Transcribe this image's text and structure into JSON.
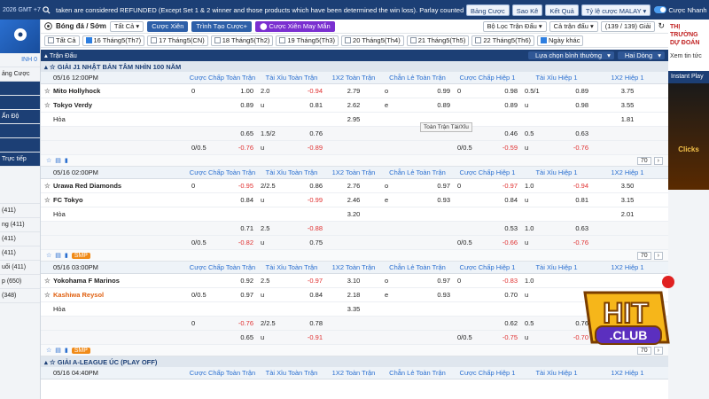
{
  "topbar": {
    "time": "2026 GMT +7",
    "news": "taken are considered REFUNDED (Except Set 1 & 2 winner and those products which have been determined the win loss). Parlay counted as",
    "buttons": [
      "Bảng Cược",
      "Sao Kê",
      "Kết Quả",
      "Tỷ lệ cược MALAY"
    ],
    "quick_bet": "Cược Nhanh"
  },
  "leftpanel": {
    "banner": "",
    "rows": [
      "INH 0",
      "ảng Cược",
      "",
      "",
      "Ấn Độ",
      "",
      "",
      "Trực tiếp",
      "",
      "(411)",
      "ng (411)",
      "(411)",
      "(411)",
      "uối (411)",
      "p (650)",
      "(348)"
    ]
  },
  "filter": {
    "sport": "Bóng đá / Sớm",
    "all": "Tất Cả",
    "btn1": "Cược Xiên",
    "btn2": "Trình Tạo Cược+",
    "btn3": "Cược Xiên May Mắn",
    "match_filter": "Bộ Lọc Trận Đấu",
    "odds_sort": "Cả trận đấu",
    "count": "(139 / 139)",
    "league_select": "Giải"
  },
  "dates": [
    "Tất Cả",
    "16 Tháng5(Th7)",
    "17 Tháng5(CN)",
    "18 Tháng5(Th2)",
    "19 Tháng5(Th3)",
    "20 Tháng5(Th4)",
    "21 Tháng5(Th5)",
    "22 Tháng5(Th6)",
    "Ngày khác"
  ],
  "section": {
    "title": "Trận Đấu",
    "sort": "Lựa chọn bình thường",
    "lines": "Hai Dòng"
  },
  "columns": [
    "Cược Chấp Toàn Trận",
    "Tài Xỉu Toàn Trận",
    "1X2 Toàn Trận",
    "Chẵn Lẻ Toàn Trận",
    "Cược Chấp Hiệp 1",
    "Tài Xỉu Hiệp 1",
    "1X2 Hiệp 1"
  ],
  "leagues": [
    "GIẢI J1 NHẬT BẢN TÂM NHÌN 100 NĂM",
    "GIẢI A-LEAGUE ÚC (PLAY OFF)"
  ],
  "tooltip": "Toàn Trận Tài/Xỉu",
  "matches": [
    {
      "time": "05/16 12:00PM",
      "home": "Mito Hollyhock",
      "away": "Tokyo Verdy",
      "draw": "Hòa",
      "rows": [
        [
          [
            "0",
            "1.00"
          ],
          [
            "2.0",
            "-0.94"
          ],
          "2.79",
          [
            "o",
            "0.99"
          ],
          [
            "0",
            "0.98"
          ],
          [
            "0.5/1",
            "0.89"
          ],
          "3.75"
        ],
        [
          [
            "",
            "0.89"
          ],
          [
            "u",
            "0.81"
          ],
          "2.62",
          [
            "e",
            "0.89"
          ],
          [
            "",
            "0.89"
          ],
          [
            "u",
            "0.98"
          ],
          "3.55"
        ],
        [
          [
            "",
            ""
          ],
          [
            "",
            ""
          ],
          "2.95",
          [
            "",
            ""
          ],
          [
            "",
            ""
          ],
          [
            "",
            ""
          ],
          "1.81"
        ],
        [
          [
            "",
            "0.65"
          ],
          [
            "1.5/2",
            "0.76"
          ],
          "",
          [
            "",
            ""
          ],
          [
            "",
            "0.46"
          ],
          [
            "0.5",
            "0.63"
          ],
          ""
        ],
        [
          [
            "0/0.5",
            "-0.76"
          ],
          [
            "u",
            "-0.89"
          ],
          "",
          [
            "",
            ""
          ],
          [
            "0/0.5",
            "-0.59"
          ],
          [
            "u",
            "-0.76"
          ],
          ""
        ]
      ],
      "nav": "70"
    },
    {
      "time": "05/16 02:00PM",
      "home": "Urawa Red Diamonds",
      "away": "FC Tokyo",
      "draw": "Hòa",
      "rows": [
        [
          [
            "0",
            "-0.95"
          ],
          [
            "2/2.5",
            "0.86"
          ],
          "2.76",
          [
            "o",
            "0.97"
          ],
          [
            "0",
            "-0.97"
          ],
          [
            "1.0",
            "-0.94"
          ],
          "3.50"
        ],
        [
          [
            "",
            "0.84"
          ],
          [
            "u",
            "-0.99"
          ],
          "2.46",
          [
            "e",
            "0.93"
          ],
          [
            "",
            "0.84"
          ],
          [
            "u",
            "0.81"
          ],
          "3.15"
        ],
        [
          [
            "",
            ""
          ],
          [
            "",
            ""
          ],
          "3.20",
          [
            "",
            ""
          ],
          [
            "",
            ""
          ],
          [
            "",
            ""
          ],
          "2.01"
        ],
        [
          [
            "",
            "0.71"
          ],
          [
            "2.5",
            "-0.88"
          ],
          "",
          [
            "",
            ""
          ],
          [
            "",
            "0.53"
          ],
          [
            "1.0",
            "0.63"
          ],
          ""
        ],
        [
          [
            "0/0.5",
            "-0.82"
          ],
          [
            "u",
            "0.75"
          ],
          "",
          [
            "",
            ""
          ],
          [
            "0/0.5",
            "-0.66"
          ],
          [
            "u",
            "-0.76"
          ],
          ""
        ]
      ],
      "nav": "70"
    },
    {
      "time": "05/16 03:00PM",
      "home": "Yokohama F Marinos",
      "away": "Kashiwa Reysol",
      "draw": "Hòa",
      "rows": [
        [
          [
            "",
            "0.92"
          ],
          [
            "2.5",
            "-0.97"
          ],
          "3.10",
          [
            "o",
            "0.97"
          ],
          [
            "0",
            "-0.83"
          ],
          [
            "1.0",
            ""
          ],
          ""
        ],
        [
          [
            "0/0.5",
            "0.97"
          ],
          [
            "u",
            "0.84"
          ],
          "2.18",
          [
            "e",
            "0.93"
          ],
          [
            "",
            "0.70"
          ],
          [
            "u",
            ""
          ],
          ""
        ],
        [
          [
            "",
            ""
          ],
          [
            "",
            ""
          ],
          "3.35",
          [
            "",
            ""
          ],
          [
            "",
            ""
          ],
          [
            "",
            ""
          ],
          ""
        ],
        [
          [
            "0",
            "-0.76"
          ],
          [
            "2/2.5",
            "0.78"
          ],
          "",
          [
            "",
            ""
          ],
          [
            "",
            "0.62"
          ],
          [
            "0.5",
            "0.76"
          ],
          ""
        ],
        [
          [
            "",
            "0.65"
          ],
          [
            "u",
            "-0.91"
          ],
          "",
          [
            "",
            ""
          ],
          [
            "0/0.5",
            "-0.75"
          ],
          [
            "u",
            "-0.70"
          ],
          ""
        ]
      ],
      "nav": "70"
    }
  ],
  "next_time": "05/16 04:40PM",
  "smp": "SMP",
  "rightpanel": {
    "ad1": "THỊ TRƯỜNG DỰ ĐOÁN",
    "ad1_sub": "Xem tin tức",
    "title": "Instant Play",
    "ad2": "Clicks"
  },
  "logo": {
    "text1": "HIT",
    "text2": ".CLUB"
  }
}
